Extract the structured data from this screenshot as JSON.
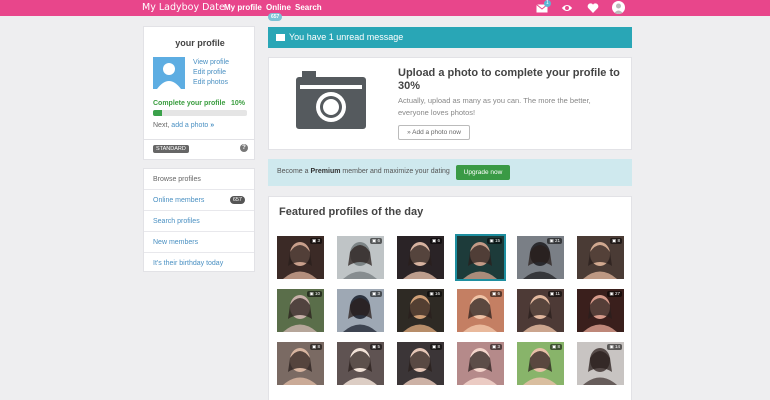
{
  "nav": {
    "brand": "My Ladyboy Date",
    "links": [
      "My profile",
      "Online",
      "Search"
    ],
    "online_count": "657",
    "mail_count": "1"
  },
  "sidebar": {
    "profile": {
      "title": "your profile",
      "links": [
        "View profile",
        "Edit profile",
        "Edit photos"
      ],
      "complete_label": "Complete your profile",
      "complete_percent": "10%",
      "complete_fraction": 0.1,
      "next_prefix": "Next,",
      "next_link": "add a photo",
      "membership": "STANDARD"
    },
    "browse": {
      "title": "Browse profiles",
      "items": [
        "Online members",
        "Search profiles",
        "New members",
        "It's their birthday today"
      ],
      "online_count": "657"
    }
  },
  "alert": {
    "text": "You have 1 unread message"
  },
  "upload": {
    "title": "Upload a photo to complete your profile to 30%",
    "description": "Actually, upload as many as you can. The more the better, everyone loves photos!",
    "button": "Add a photo now"
  },
  "premium": {
    "prefix": "Become a",
    "bold": "Premium",
    "suffix": "member and maximize your dating",
    "button": "Upgrade now"
  },
  "featured": {
    "title": "Featured profiles of the day",
    "photos": [
      {
        "badge": "3"
      },
      {
        "badge": "6"
      },
      {
        "badge": "6"
      },
      {
        "badge": "15"
      },
      {
        "badge": "21"
      },
      {
        "badge": "8"
      },
      {
        "badge": "10"
      },
      {
        "badge": "3"
      },
      {
        "badge": "16"
      },
      {
        "badge": "6"
      },
      {
        "badge": "11"
      },
      {
        "badge": "27"
      },
      {
        "badge": "8"
      },
      {
        "badge": "5"
      },
      {
        "badge": "8"
      },
      {
        "badge": "3"
      },
      {
        "badge": "8"
      },
      {
        "badge": "14"
      }
    ]
  },
  "colors": {
    "brand_pink": "#e8468b",
    "teal": "#29a6b6",
    "green": "#3a9a45"
  }
}
